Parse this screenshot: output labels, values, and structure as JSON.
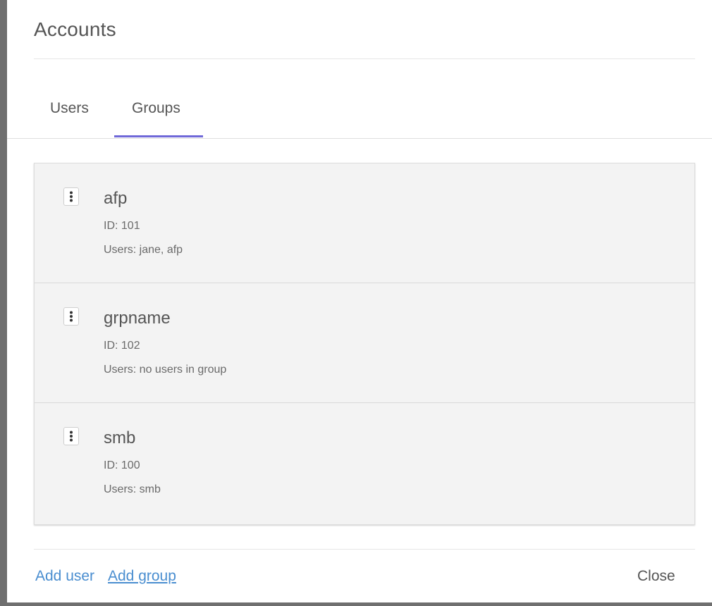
{
  "dialog": {
    "title": "Accounts"
  },
  "tabs": [
    {
      "label": "Users",
      "active": false
    },
    {
      "label": "Groups",
      "active": true
    }
  ],
  "accent_color": "#6f68d8",
  "link_color": "#4a8ed0",
  "groups": [
    {
      "name": "afp",
      "id_text": "ID: 101",
      "users_text": "Users: jane, afp",
      "menu_icon": "more-vertical-icon"
    },
    {
      "name": "grpname",
      "id_text": "ID: 102",
      "users_text": "Users: no users in group",
      "menu_icon": "more-vertical-icon"
    },
    {
      "name": "smb",
      "id_text": "ID: 100",
      "users_text": "Users: smb",
      "menu_icon": "more-vertical-icon"
    }
  ],
  "footer": {
    "add_user": "Add user",
    "add_group": "Add group",
    "close": "Close"
  }
}
